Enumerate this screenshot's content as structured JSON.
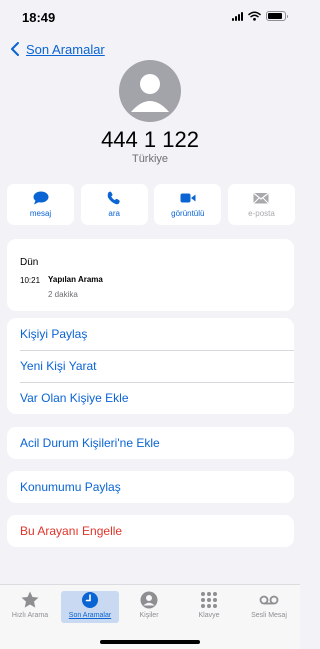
{
  "status_bar": {
    "time": "18:49",
    "battery_level": 0.85
  },
  "nav": {
    "back_label": "Son Aramalar"
  },
  "contact": {
    "number": "444 1 122",
    "country": "Türkiye"
  },
  "actions": [
    {
      "label": "mesaj",
      "icon": "message-icon",
      "enabled": true
    },
    {
      "label": "ara",
      "icon": "phone-icon",
      "enabled": true
    },
    {
      "label": "görüntülü",
      "icon": "video-icon",
      "enabled": true
    },
    {
      "label": "e-posta",
      "icon": "mail-icon",
      "enabled": false
    }
  ],
  "recent": {
    "date": "Dün",
    "time": "10:21",
    "type": "Yapılan Arama",
    "duration": "2 dakika"
  },
  "options": {
    "share_contact": "Kişiyi Paylaş",
    "create_contact": "Yeni Kişi Yarat",
    "add_existing": "Var Olan Kişiye Ekle",
    "add_emergency": "Acil Durum Kişileri'ne Ekle",
    "share_location": "Konumumu Paylaş",
    "block_caller": "Bu Arayanı Engelle"
  },
  "tabs": [
    {
      "label": "Hızlı Arama",
      "icon": "star-icon",
      "active": false
    },
    {
      "label": "Son Aramalar",
      "icon": "clock-icon",
      "active": true
    },
    {
      "label": "Kişiler",
      "icon": "person-circle-icon",
      "active": false
    },
    {
      "label": "Klavye",
      "icon": "keypad-icon",
      "active": false
    },
    {
      "label": "Sesli Mesaj",
      "icon": "voicemail-icon",
      "active": false
    }
  ],
  "colors": {
    "accent": "#0a64d4",
    "danger": "#e0352b",
    "background": "#f2f2f7",
    "avatar": "#a3a3aa"
  }
}
